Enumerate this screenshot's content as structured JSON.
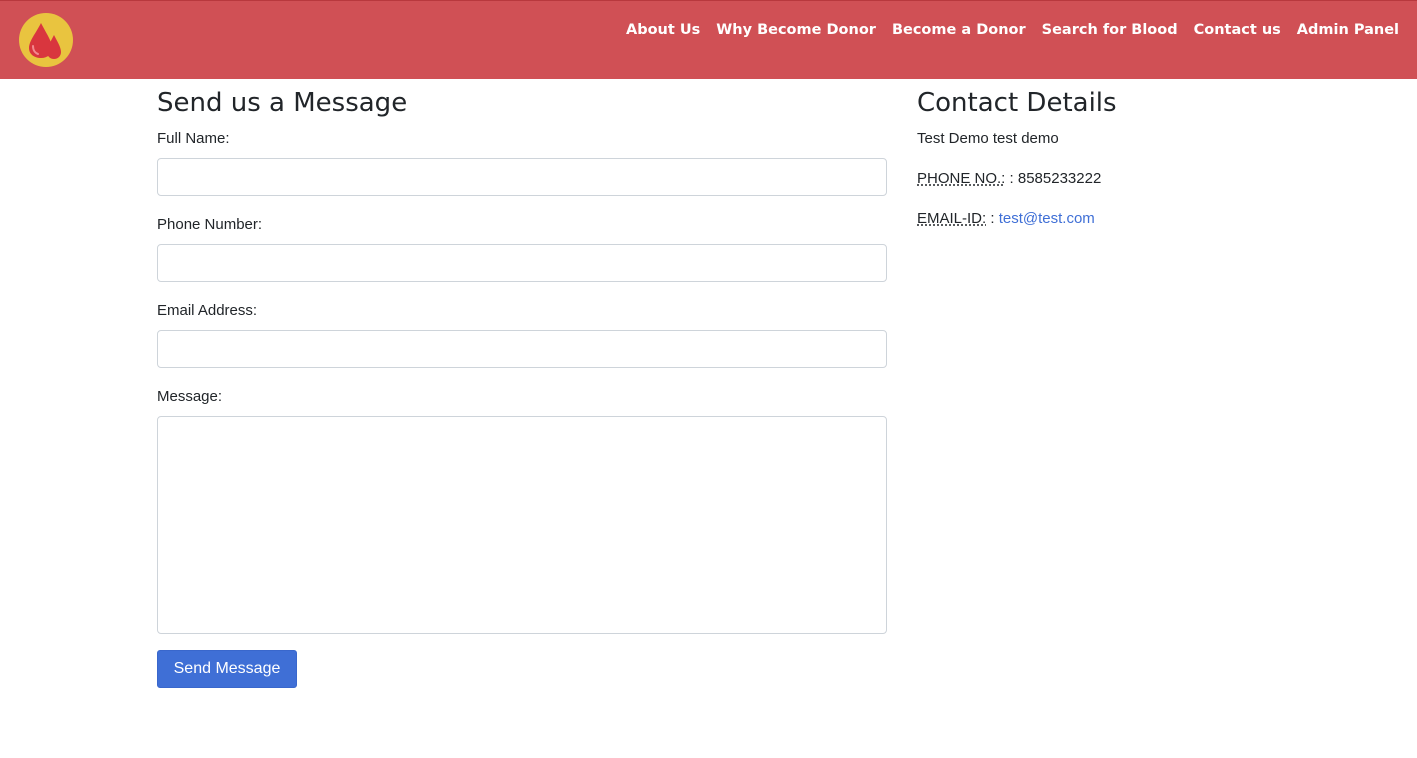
{
  "brand": {
    "logo_icon": "blood-drops-icon",
    "colors": {
      "navbar": "#d05055",
      "logo_circle": "#e9c43f",
      "drop": "#d9363e",
      "button": "#3f6fd6",
      "link": "#3f6fd6"
    }
  },
  "nav": {
    "items": [
      {
        "label": "About Us"
      },
      {
        "label": "Why Become Donor"
      },
      {
        "label": "Become a Donor"
      },
      {
        "label": "Search for Blood"
      },
      {
        "label": "Contact us"
      },
      {
        "label": "Admin Panel"
      }
    ]
  },
  "form": {
    "title": "Send us a Message",
    "fields": {
      "full_name": {
        "label": "Full Name:",
        "value": "",
        "placeholder": ""
      },
      "phone": {
        "label": "Phone Number:",
        "value": "",
        "placeholder": ""
      },
      "email": {
        "label": "Email Address:",
        "value": "",
        "placeholder": ""
      },
      "message": {
        "label": "Message:",
        "value": "",
        "placeholder": ""
      }
    },
    "submit_label": "Send Message"
  },
  "contact": {
    "title": "Contact Details",
    "name": "Test Demo test demo",
    "phone_label": "PHONE NO.:",
    "phone_value": " : 8585233222",
    "email_label": "EMAIL-ID:",
    "email_sep": " : ",
    "email_value": "test@test.com"
  }
}
